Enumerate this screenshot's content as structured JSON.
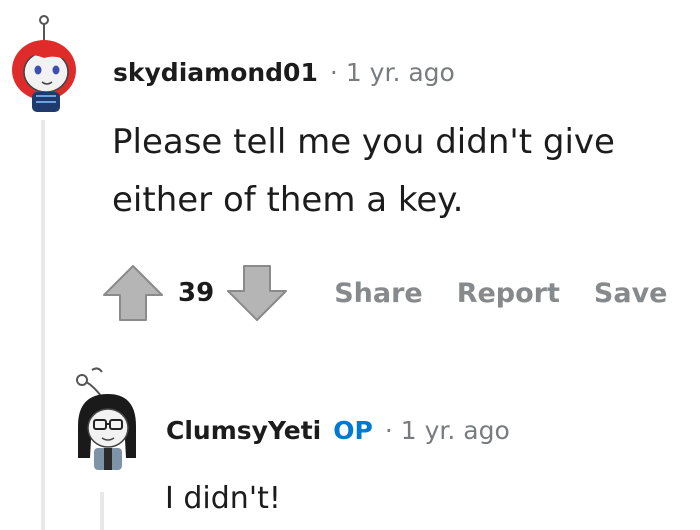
{
  "comment1": {
    "username": "skydiamond01",
    "separator": "·",
    "time": "1 yr. ago",
    "body_line1": "Please tell me you didn't give",
    "body_line2": "either of them a key.",
    "score": "39",
    "share_label": "Share",
    "report_label": "Report",
    "save_label": "Save"
  },
  "comment2": {
    "username": "ClumsyYeti",
    "op_badge": "OP",
    "separator": "·",
    "time": "1 yr. ago",
    "body": "I didn't!"
  },
  "colors": {
    "op_badge": "#0079d3",
    "meta_text": "#787c7e",
    "action_text": "#878a8c",
    "thread_line": "#e8e8e8"
  }
}
